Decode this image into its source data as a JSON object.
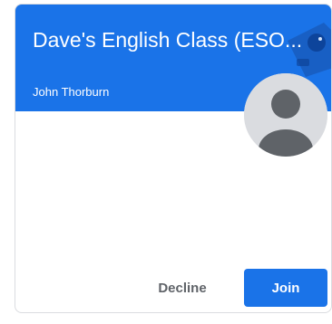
{
  "invite_card": {
    "class_name": "Dave's English Class (ESO...",
    "owner_name": "John Thorburn",
    "decline_label": "Decline",
    "join_label": "Join"
  },
  "colors": {
    "banner": "#1a73e8",
    "join_button": "#1a73e8",
    "decline_text": "#5f6368",
    "border": "#dadce0"
  },
  "icons": [
    "user-avatar-icon",
    "banner-illustration"
  ]
}
